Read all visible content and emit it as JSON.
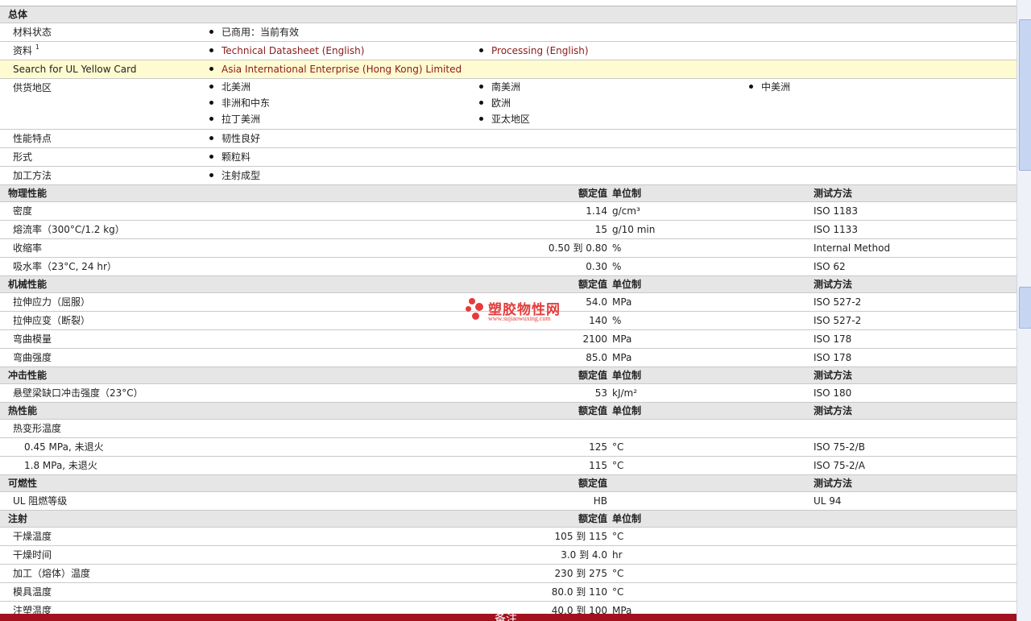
{
  "general": {
    "header": "总体",
    "material_status_label": "材料状态",
    "material_status_value": "已商用：当前有效",
    "info_label": "资料",
    "info_sup": "1",
    "info_link1": "Technical Datasheet (English)",
    "info_link2": "Processing (English)",
    "ul_label": "Search for UL Yellow Card",
    "ul_value": "Asia International Enterprise (Hong Kong) Limited",
    "supply_label": "供货地区",
    "regions": [
      "北美洲",
      "南美洲",
      "中美洲",
      "非洲和中东",
      "欧洲",
      "拉丁美洲",
      "亚太地区"
    ],
    "features_label": "性能特点",
    "features_value": "韧性良好",
    "form_label": "形式",
    "form_value": "颗粒料",
    "process_label": "加工方法",
    "process_value": "注射成型"
  },
  "columns": {
    "nominal": "额定值",
    "unit": "单位制",
    "method": "测试方法"
  },
  "physical": {
    "header": "物理性能",
    "rows": [
      {
        "label": "密度",
        "value": "1.14",
        "unit": "g/cm³",
        "method": "ISO 1183"
      },
      {
        "label": "熔流率（300°C/1.2 kg）",
        "value": "15",
        "unit": "g/10 min",
        "method": "ISO 1133"
      },
      {
        "label": "收缩率",
        "value": "0.50 到  0.80",
        "unit": "%",
        "method": "Internal Method"
      },
      {
        "label": "吸水率（23°C, 24 hr）",
        "value": "0.30",
        "unit": "%",
        "method": "ISO 62"
      }
    ]
  },
  "mechanical": {
    "header": "机械性能",
    "rows": [
      {
        "label": "拉伸应力（屈服）",
        "value": "54.0",
        "unit": "MPa",
        "method": "ISO 527-2"
      },
      {
        "label": "拉伸应变（断裂）",
        "value": "140",
        "unit": "%",
        "method": "ISO 527-2"
      },
      {
        "label": "弯曲模量",
        "value": "2100",
        "unit": "MPa",
        "method": "ISO 178"
      },
      {
        "label": "弯曲强度",
        "value": "85.0",
        "unit": "MPa",
        "method": "ISO 178"
      }
    ]
  },
  "impact": {
    "header": "冲击性能",
    "rows": [
      {
        "label": "悬壁梁缺口冲击强度（23°C）",
        "value": "53",
        "unit": "kJ/m²",
        "method": "ISO 180"
      }
    ]
  },
  "thermal": {
    "header": "热性能",
    "parent_label": "热变形温度",
    "rows": [
      {
        "label": "0.45 MPa, 未退火",
        "value": "125",
        "unit": "°C",
        "method": "ISO 75-2/B"
      },
      {
        "label": "1.8 MPa, 未退火",
        "value": "115",
        "unit": "°C",
        "method": "ISO 75-2/A"
      }
    ]
  },
  "flammability": {
    "header": "可燃性",
    "rows": [
      {
        "label": "UL 阻燃等级",
        "value": "HB",
        "unit": "",
        "method": "UL 94"
      }
    ]
  },
  "injection": {
    "header": "注射",
    "rows": [
      {
        "label": "干燥温度",
        "value": "105 到  115",
        "unit": "°C"
      },
      {
        "label": "干燥时间",
        "value": "3.0 到  4.0",
        "unit": "hr"
      },
      {
        "label": "加工（熔体）温度",
        "value": "230 到  275",
        "unit": "°C"
      },
      {
        "label": "模具温度",
        "value": "80.0 到  110",
        "unit": "°C"
      },
      {
        "label": "注塑温度",
        "value": "40.0 到  100",
        "unit": "MPa"
      }
    ]
  },
  "footer": {
    "label": "备注"
  },
  "watermark": {
    "name": "塑胶物性网",
    "url": "www.sujiaowuxing.com"
  },
  "colors": {
    "header_bg": "#e6e6e6",
    "highlight_bg": "#fffbd0",
    "link": "#8b1a1a",
    "footer_bg": "#a1121e",
    "watermark": "#e53b3b"
  }
}
